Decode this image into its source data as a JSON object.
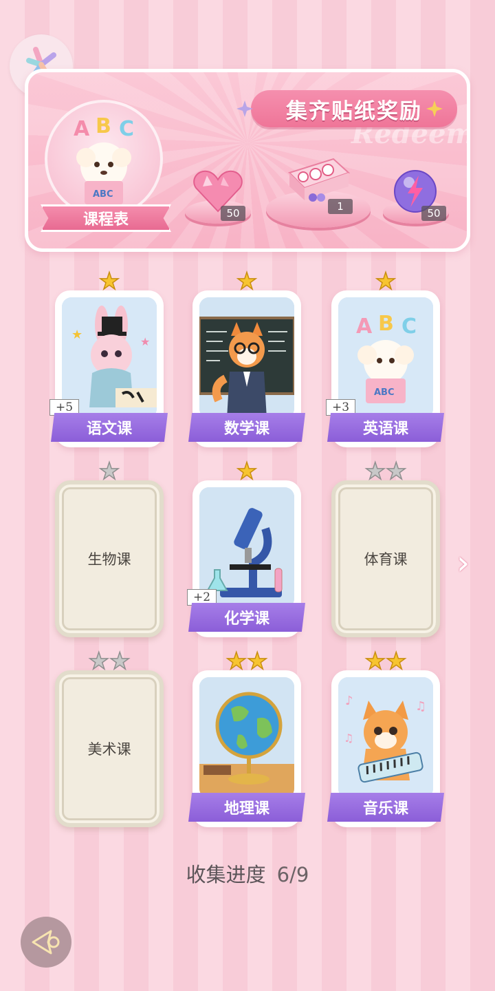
{
  "banner": {
    "title": "集齐贴纸奖励",
    "watermark": "Redeem",
    "schedule_label": "课程表",
    "rewards": [
      {
        "icon": "pink-heart-gem-icon",
        "count": "50"
      },
      {
        "icon": "gift-box-icon",
        "count": "1"
      },
      {
        "icon": "lightning-orb-icon",
        "count": "50"
      }
    ]
  },
  "cards": [
    {
      "label": "语文课",
      "stars": 1,
      "unlocked": true,
      "bonus": "+5",
      "art": "rabbit-calligraphy"
    },
    {
      "label": "数学课",
      "stars": 1,
      "unlocked": true,
      "bonus": "",
      "art": "fox-teacher"
    },
    {
      "label": "英语课",
      "stars": 1,
      "unlocked": true,
      "bonus": "+3",
      "art": "poodle-abc"
    },
    {
      "label": "生物课",
      "stars": 1,
      "unlocked": false,
      "bonus": "",
      "art": ""
    },
    {
      "label": "化学课",
      "stars": 1,
      "unlocked": true,
      "bonus": "+2",
      "art": "microscope"
    },
    {
      "label": "体育课",
      "stars": 2,
      "unlocked": false,
      "bonus": "",
      "art": ""
    },
    {
      "label": "美术课",
      "stars": 2,
      "unlocked": false,
      "bonus": "",
      "art": ""
    },
    {
      "label": "地理课",
      "stars": 2,
      "unlocked": true,
      "bonus": "",
      "art": "globe"
    },
    {
      "label": "音乐课",
      "stars": 2,
      "unlocked": true,
      "bonus": "",
      "art": "cat-keyboard"
    }
  ],
  "progress": {
    "label": "收集进度",
    "value": "6/9"
  },
  "colors": {
    "ribbon": "#8b5ed8",
    "accent_pink": "#ef7598",
    "star_gold": "#f7c430"
  }
}
